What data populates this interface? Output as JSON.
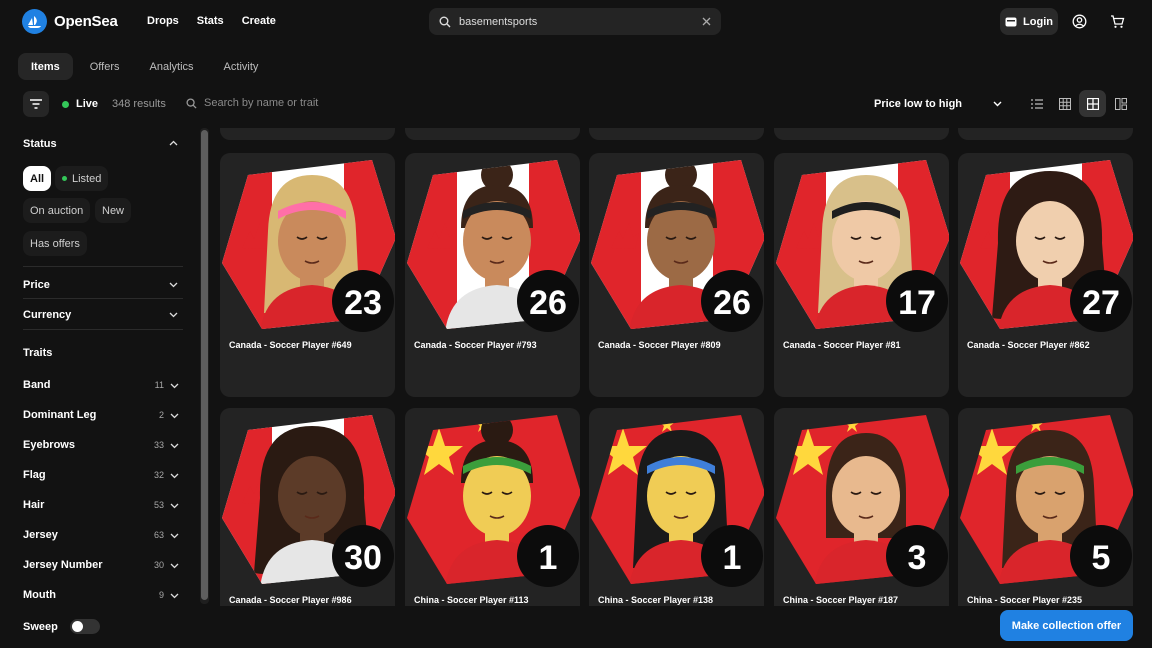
{
  "app": {
    "name": "OpenSea"
  },
  "nav": {
    "links": [
      "Drops",
      "Stats",
      "Create"
    ]
  },
  "search": {
    "value": "basementsports"
  },
  "login": {
    "label": "Login"
  },
  "tabs": [
    {
      "label": "Items",
      "active": true
    },
    {
      "label": "Offers",
      "active": false
    },
    {
      "label": "Analytics",
      "active": false
    },
    {
      "label": "Activity",
      "active": false
    }
  ],
  "toolbar": {
    "live_label": "Live",
    "results": "348 results",
    "search_placeholder": "Search by name or trait",
    "sort_label": "Price low to high"
  },
  "sidebar": {
    "status_heading": "Status",
    "status_pills": [
      {
        "label": "All",
        "active": true
      },
      {
        "label": "Listed",
        "active": false
      },
      {
        "label": "On auction",
        "active": false
      },
      {
        "label": "New",
        "active": false
      },
      {
        "label": "Has offers",
        "active": false
      }
    ],
    "price": "Price",
    "currency": "Currency",
    "traits_heading": "Traits",
    "traits": [
      {
        "name": "Band",
        "count": "11"
      },
      {
        "name": "Dominant Leg",
        "count": "2"
      },
      {
        "name": "Eyebrows",
        "count": "33"
      },
      {
        "name": "Flag",
        "count": "32"
      },
      {
        "name": "Hair",
        "count": "53"
      },
      {
        "name": "Jersey",
        "count": "63"
      },
      {
        "name": "Jersey Number",
        "count": "30"
      },
      {
        "name": "Mouth",
        "count": "9"
      }
    ],
    "sweep_label": "Sweep"
  },
  "cards": [
    {
      "name": "Canada - Soccer Player #649",
      "number": "23",
      "flag": "canada",
      "skin": "#c98a5c",
      "hair": "#d8b873",
      "hair_style": "long",
      "band": "#ff6fa8",
      "shirt": "#d9252b"
    },
    {
      "name": "Canada - Soccer Player #793",
      "number": "26",
      "flag": "canada",
      "skin": "#c98a5c",
      "hair": "#3b2418",
      "hair_style": "bun",
      "band": "#222222",
      "shirt": "#e6e6e6"
    },
    {
      "name": "Canada - Soccer Player #809",
      "number": "26",
      "flag": "canada",
      "skin": "#9c6a45",
      "hair": "#3b2418",
      "hair_style": "bun",
      "band": "#222222",
      "shirt": "#d9252b"
    },
    {
      "name": "Canada - Soccer Player #81",
      "number": "17",
      "flag": "canada",
      "skin": "#efc9a6",
      "hair": "#d8c08a",
      "hair_style": "long",
      "band": "#1e1e1e",
      "shirt": "#d9252b"
    },
    {
      "name": "Canada - Soccer Player #862",
      "number": "27",
      "flag": "canada",
      "skin": "#f0cfae",
      "hair": "#2e1b14",
      "hair_style": "curly",
      "band": "",
      "shirt": "#d9252b"
    },
    {
      "name": "Canada - Soccer Player #986",
      "number": "30",
      "flag": "canada",
      "skin": "#5c3b28",
      "hair": "#2a1a12",
      "hair_style": "curly",
      "band": "",
      "shirt": "#e6e6e6"
    },
    {
      "name": "China - Soccer Player #113",
      "number": "1",
      "flag": "china",
      "skin": "#f0cc55",
      "hair": "#2a1a12",
      "hair_style": "bun",
      "band": "#3b9e3b",
      "shirt": "#d9252b"
    },
    {
      "name": "China - Soccer Player #138",
      "number": "1",
      "flag": "china",
      "skin": "#f0cc55",
      "hair": "#1a1a1a",
      "hair_style": "long",
      "band": "#3f7fd9",
      "shirt": "#d9252b"
    },
    {
      "name": "China - Soccer Player #187",
      "number": "3",
      "flag": "china",
      "skin": "#e8b98e",
      "hair": "#3b2418",
      "hair_style": "bob",
      "band": "",
      "shirt": "#d9252b"
    },
    {
      "name": "China - Soccer Player #235",
      "number": "5",
      "flag": "china",
      "skin": "#d9a26e",
      "hair": "#3b2418",
      "hair_style": "long",
      "band": "#3b9e3b",
      "shirt": "#d9252b"
    }
  ],
  "offer_button": "Make collection offer",
  "colors": {
    "accent": "#2081e2",
    "live": "#34c759",
    "flag_red": "#e0252b"
  }
}
